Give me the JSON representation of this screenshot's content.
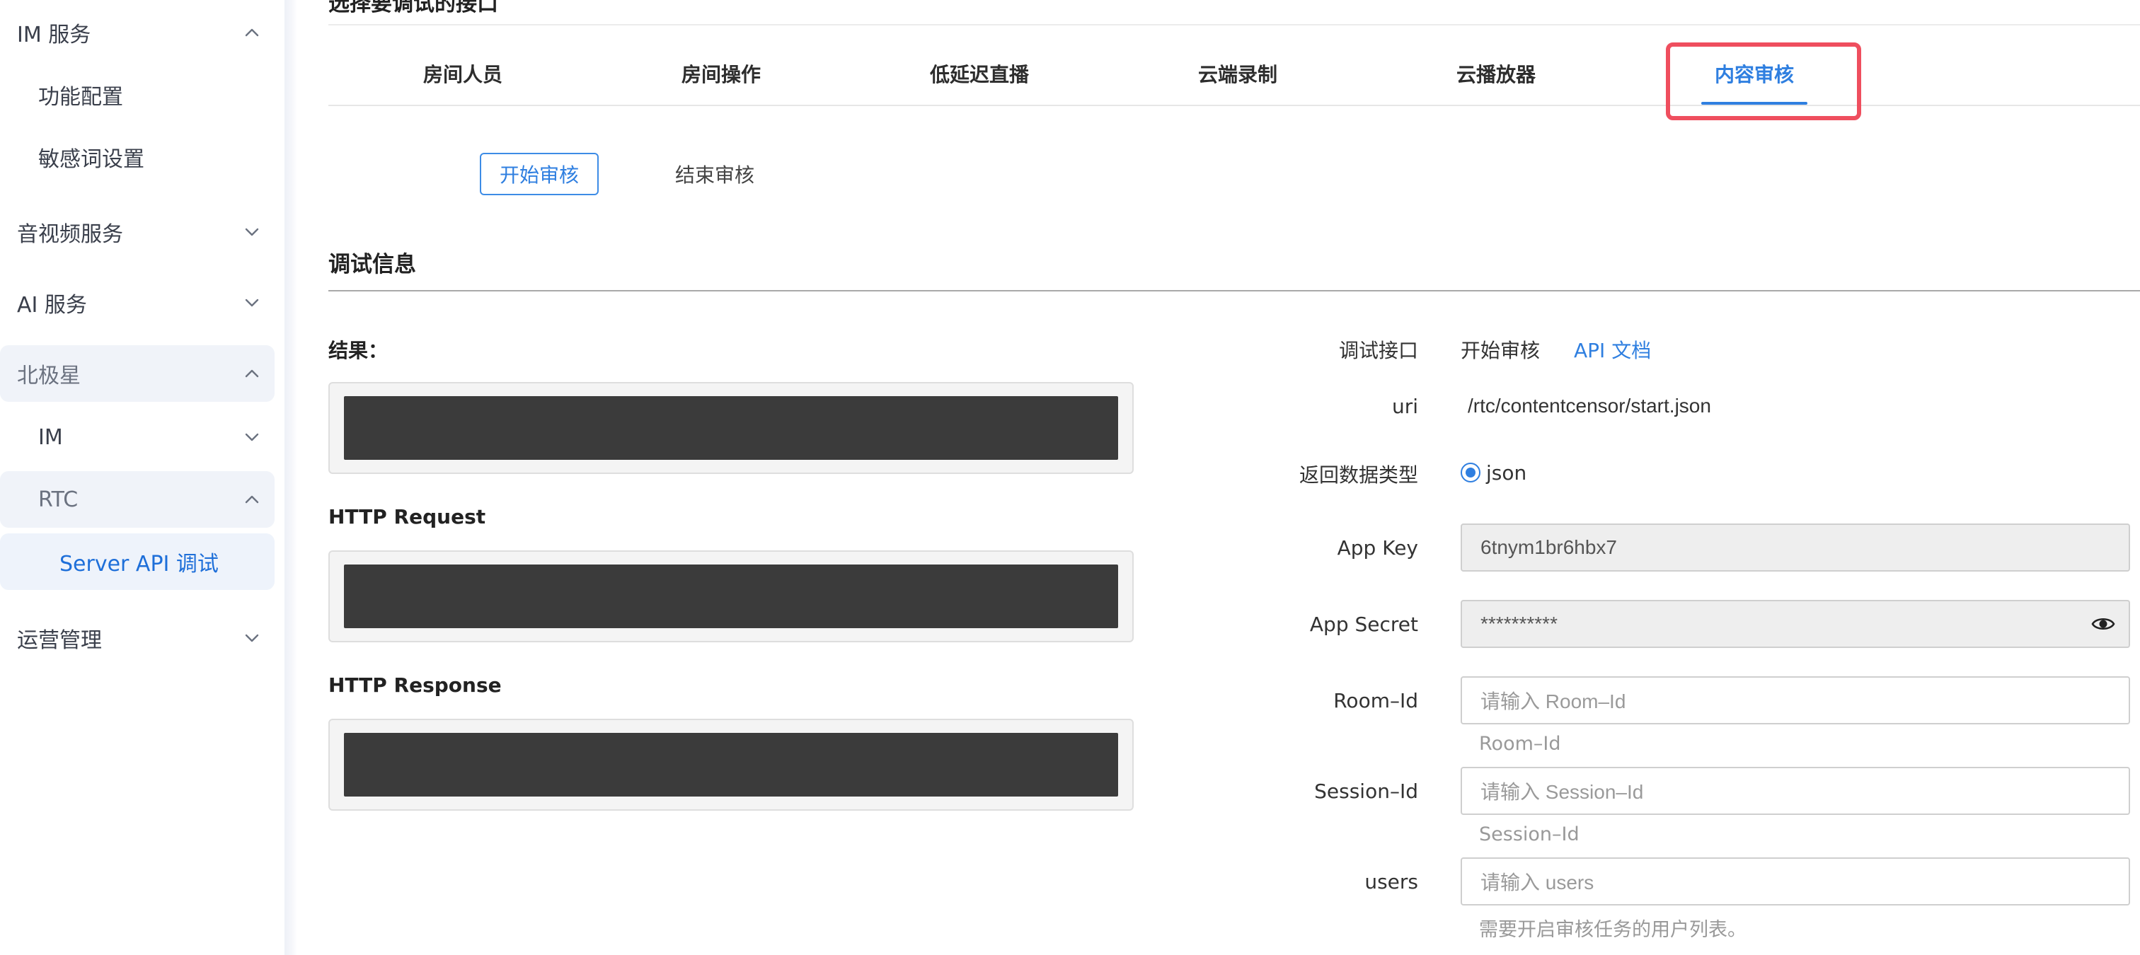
{
  "sidebar": {
    "im_service": "IM 服务",
    "feature_config": "功能配置",
    "sensitive_words": "敏感词设置",
    "av_service": "音视频服务",
    "ai_service": "AI 服务",
    "polaris": "北极星",
    "im": "IM",
    "rtc": "RTC",
    "server_api_debug": "Server API 调试",
    "ops": "运营管理"
  },
  "header": {
    "cut_title": "选择要调试的接口"
  },
  "tabs": [
    {
      "label": "房间人员"
    },
    {
      "label": "房间操作"
    },
    {
      "label": "低延迟直播"
    },
    {
      "label": "云端录制"
    },
    {
      "label": "云播放器"
    },
    {
      "label": "内容审核",
      "active": true
    }
  ],
  "sub_actions": {
    "start": "开始审核",
    "end": "结束审核"
  },
  "debug": {
    "title": "调试信息",
    "result_label": "结果：",
    "http_request_label": "HTTP Request",
    "http_response_label": "HTTP Response"
  },
  "form": {
    "api_label": "调试接口",
    "api_value": "开始审核",
    "api_doc_link": "API 文档",
    "uri_label": "uri",
    "uri_value": "/rtc/contentcensor/start.json",
    "return_type_label": "返回数据类型",
    "return_type_value": "json",
    "app_key_label": "App Key",
    "app_key_value": "6tnym1br6hbx7",
    "app_secret_label": "App Secret",
    "app_secret_value": "**********",
    "room_id_label": "Room–Id",
    "room_id_placeholder": "请输入 Room–Id",
    "room_id_hint": "Room–Id",
    "session_id_label": "Session–Id",
    "session_id_placeholder": "请输入 Session–Id",
    "session_id_hint": "Session–Id",
    "users_label": "users",
    "users_placeholder": "请输入 users",
    "users_hint": "需要开启审核任务的用户列表。"
  },
  "colors": {
    "accent": "#2f7fe0",
    "highlight_box": "#ef4e5e",
    "result_fill": "#3b3b3b"
  }
}
